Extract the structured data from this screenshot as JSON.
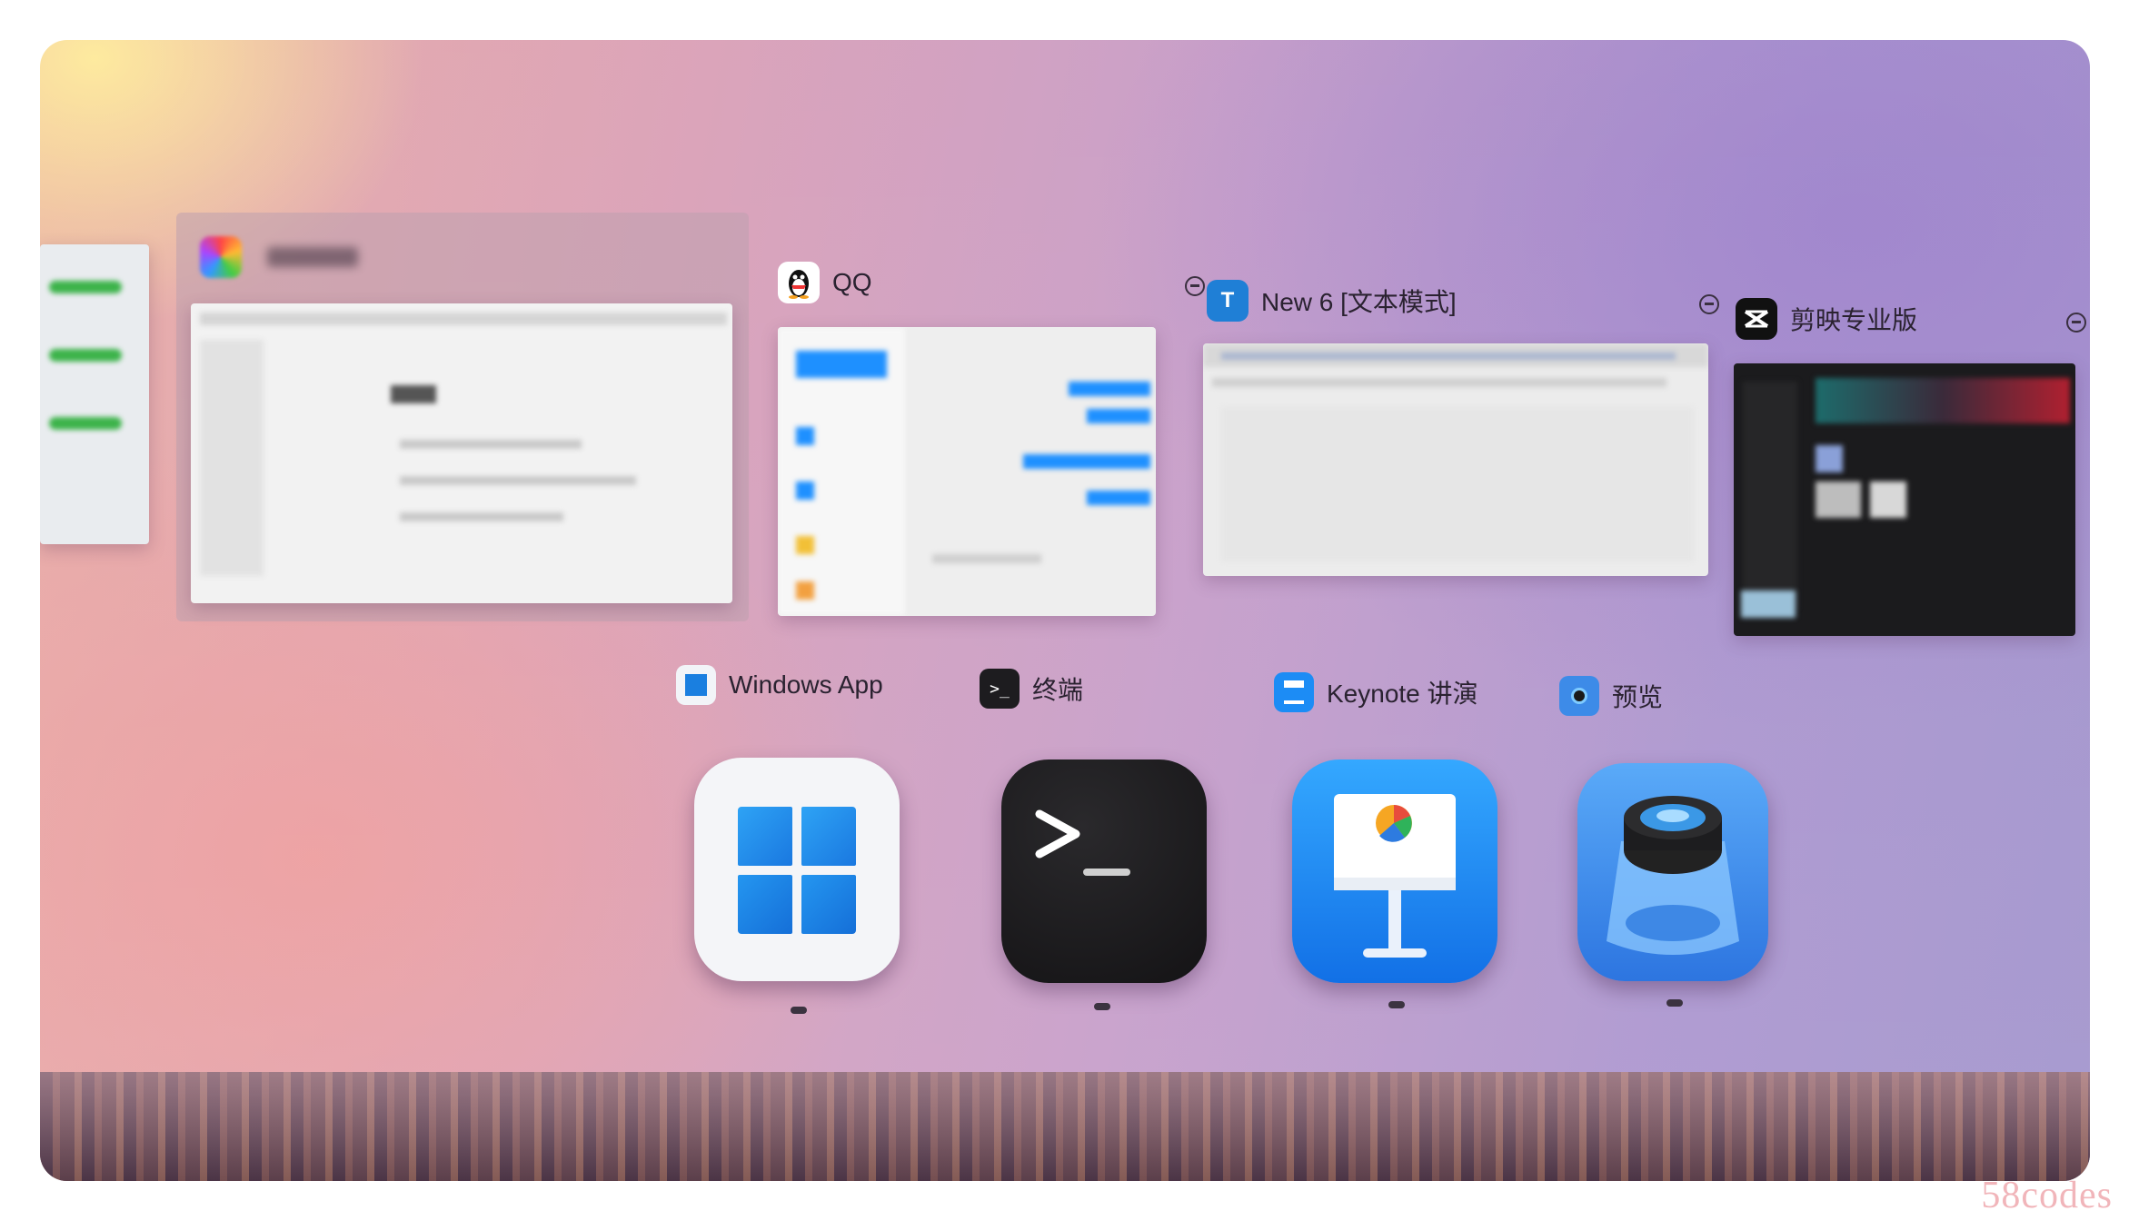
{
  "switcher": {
    "windows": [
      {
        "title": "",
        "icon": "blurred-app-icon",
        "blurred": true
      },
      {
        "title": "QQ",
        "icon": "qq-penguin-icon"
      },
      {
        "title": "New 6 [文本模式]",
        "icon": "text-editor-t-icon"
      },
      {
        "title": "剪映专业版",
        "icon": "capcut-icon"
      }
    ],
    "apps": [
      {
        "label": "Windows App",
        "icon": "windows-app-icon"
      },
      {
        "label": "终端",
        "icon": "terminal-icon"
      },
      {
        "label": "Keynote 讲演",
        "icon": "keynote-icon"
      },
      {
        "label": "预览",
        "icon": "preview-icon"
      }
    ],
    "terminal_prompt": ">_",
    "text_editor_letter": "T"
  },
  "watermark": "58codes",
  "colors": {
    "qq_blue": "#1e90ff",
    "windows_blue": "#1a7fe0",
    "keynote_blue": "#1c8cf5",
    "terminal_black": "#1d1c1f"
  }
}
